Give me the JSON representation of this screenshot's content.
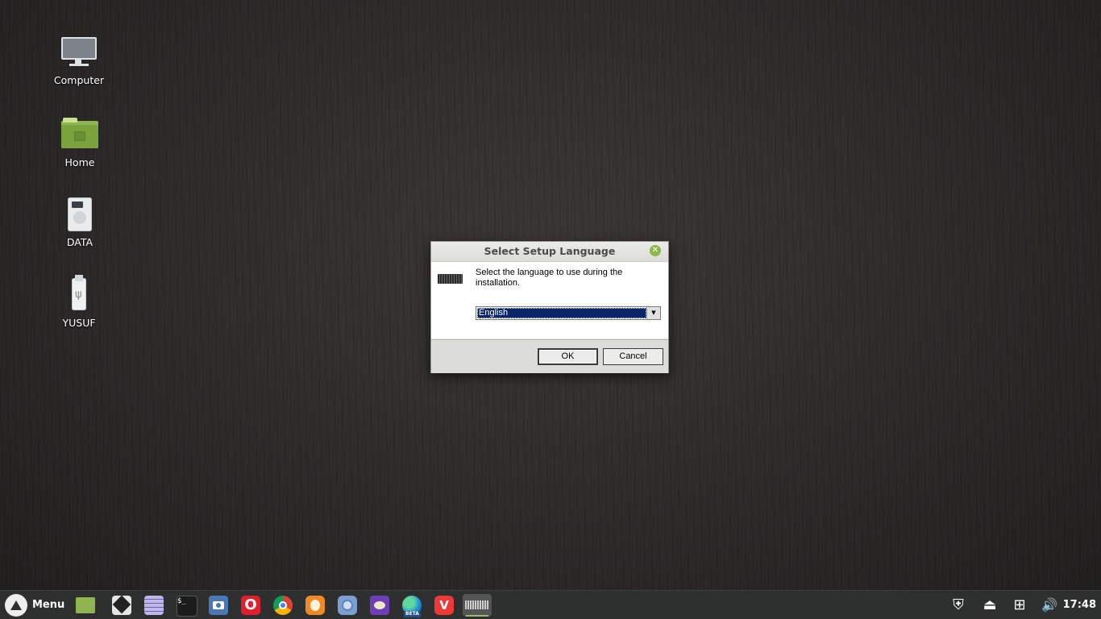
{
  "desktop": {
    "icons": [
      {
        "label": "Computer",
        "icon": "computer-icon"
      },
      {
        "label": "Home",
        "icon": "home-folder-icon"
      },
      {
        "label": "DATA",
        "icon": "drive-icon"
      },
      {
        "label": "YUSUF",
        "icon": "usb-drive-icon"
      }
    ]
  },
  "dialog": {
    "title": "Select Setup Language",
    "close_symbol": "✕",
    "message": "Select the language to use during the installation.",
    "language_select": {
      "selected": "English",
      "arrow": "▼"
    },
    "ok_label": "OK",
    "cancel_label": "Cancel"
  },
  "taskbar": {
    "menu_label": "Menu",
    "apps": [
      {
        "name": "file-manager"
      },
      {
        "name": "inkscape"
      },
      {
        "name": "text-editor"
      },
      {
        "name": "terminal",
        "glyph": "$_"
      },
      {
        "name": "screenshot"
      },
      {
        "name": "opera",
        "glyph": "O"
      },
      {
        "name": "chrome"
      },
      {
        "name": "firefox"
      },
      {
        "name": "chromium"
      },
      {
        "name": "gimp"
      },
      {
        "name": "edge-beta",
        "badge": "BETA"
      },
      {
        "name": "vivaldi",
        "glyph": "V"
      },
      {
        "name": "setup-window",
        "active": true
      }
    ],
    "tray": {
      "shield_glyph": "⛨",
      "eject_glyph": "⏏",
      "network_glyph": "⊞",
      "volume_glyph": "🔊",
      "clock": "17:48"
    }
  },
  "colors": {
    "accent_green": "#8cb84a",
    "selection_blue": "#0a246a",
    "taskbar": "#2e2f2f"
  }
}
